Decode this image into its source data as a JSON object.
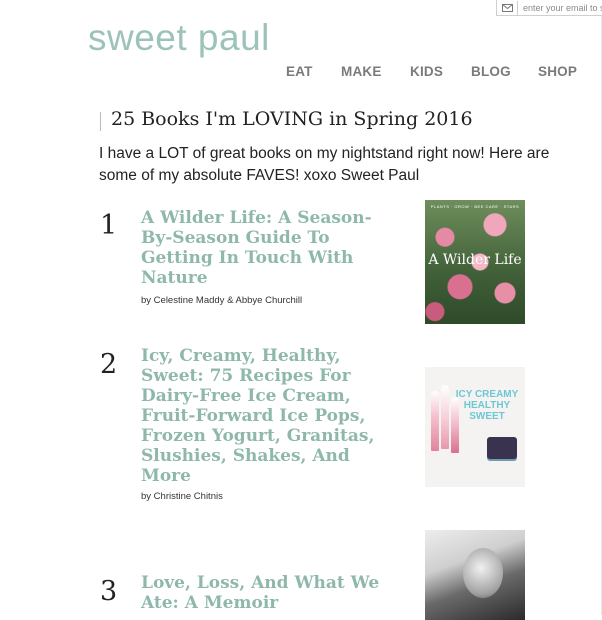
{
  "newsletter": {
    "placeholder": "enter your email to sign up"
  },
  "logo": {
    "text": "sweet paul"
  },
  "nav": [
    "EAT",
    "MAKE",
    "KIDS",
    "BLOG",
    "SHOP"
  ],
  "article": {
    "title": "25 Books I'm LOVING in Spring 2016",
    "intro": "I have a LOT of great books on my nightstand right now! Here are some of my absolute FAVES! xoxo Sweet Paul"
  },
  "books": [
    {
      "number": "1",
      "title": "A Wilder Life: A Season-By-Season Guide To Getting In Touch With Nature",
      "author": "by Celestine Maddy & Abbye Churchill",
      "cover_text": "A Wilder Life",
      "cover_strip": "PLANTS · GROW · BEE CARE · STARS",
      "cover_icon": "wilder-life-cover"
    },
    {
      "number": "2",
      "title": "Icy, Creamy, Healthy, Sweet: 75 Recipes For Dairy-Free Ice Cream, Fruit-Forward Ice Pops, Frozen Yogurt, Granitas, Slushies, Shakes, And More",
      "author": "by Christine Chitnis",
      "cover_text": "ICY CREAMY HEALTHY SWEET",
      "cover_icon": "icy-creamy-cover"
    },
    {
      "number": "3",
      "title": "Love, Loss, And What We Ate: A Memoir",
      "author": "",
      "cover_icon": "love-loss-cover"
    }
  ],
  "colors": {
    "brand": "#9cc3b9",
    "book_title": "#8fb8ad",
    "nav": "#7a7a7a"
  }
}
